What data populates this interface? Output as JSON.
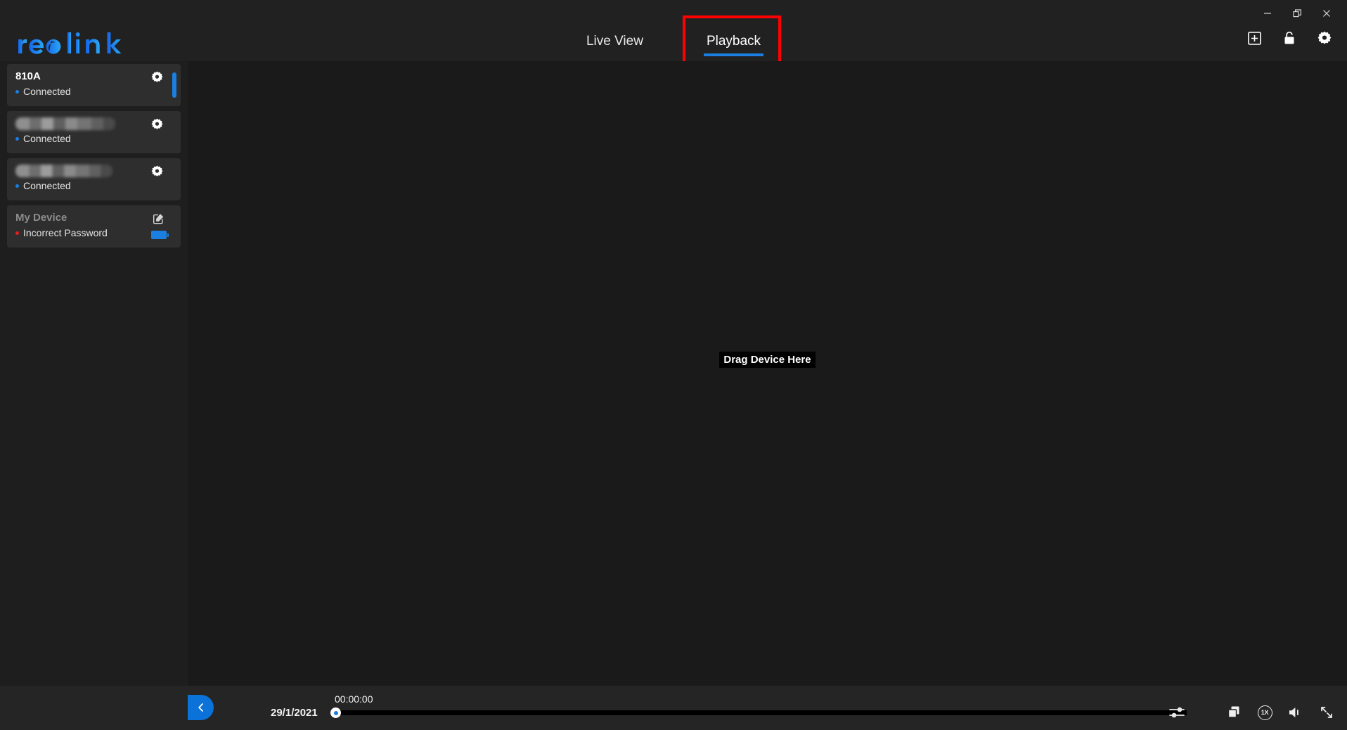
{
  "window": {
    "minimize_label": "Minimize",
    "restore_label": "Restore",
    "close_label": "Close"
  },
  "brand": {
    "name": "reolink",
    "accent_color": "#1a7fe0"
  },
  "nav": {
    "items": [
      {
        "label": "Live View",
        "active": false
      },
      {
        "label": "Playback",
        "active": true
      }
    ],
    "annotation_color": "#fe0000"
  },
  "header_tools": [
    {
      "name": "add-device-icon",
      "label": "Add Device"
    },
    {
      "name": "unlock-icon",
      "label": "Unlock"
    },
    {
      "name": "settings-gear-icon",
      "label": "Settings"
    }
  ],
  "sidebar": {
    "devices": [
      {
        "name": "810A",
        "status": "Connected",
        "status_color": "#1a7fe0",
        "redacted": false,
        "selected": true,
        "action": "gear"
      },
      {
        "name": "",
        "status": "Connected",
        "status_color": "#1a7fe0",
        "redacted": true,
        "selected": false,
        "action": "gear"
      },
      {
        "name": "",
        "status": "Connected",
        "status_color": "#1a7fe0",
        "redacted": true,
        "selected": false,
        "action": "gear"
      },
      {
        "name": "My Device",
        "status": "Incorrect Password",
        "status_color": "#e02020",
        "redacted": false,
        "selected": false,
        "action": "edit"
      }
    ]
  },
  "stage": {
    "drag_hint": "Drag Device Here"
  },
  "playback": {
    "collapse_label": "Collapse",
    "date": "29/1/2021",
    "time": "00:00:00",
    "progress_percent": 0,
    "speed": "1X",
    "tools": [
      {
        "name": "filter-icon",
        "label": "Filter"
      },
      {
        "name": "layers-icon",
        "label": "Multi-Clip"
      },
      {
        "name": "playback-speed-badge",
        "label": "1X"
      },
      {
        "name": "volume-icon",
        "label": "Volume"
      },
      {
        "name": "fullscreen-icon",
        "label": "Fullscreen"
      }
    ]
  }
}
